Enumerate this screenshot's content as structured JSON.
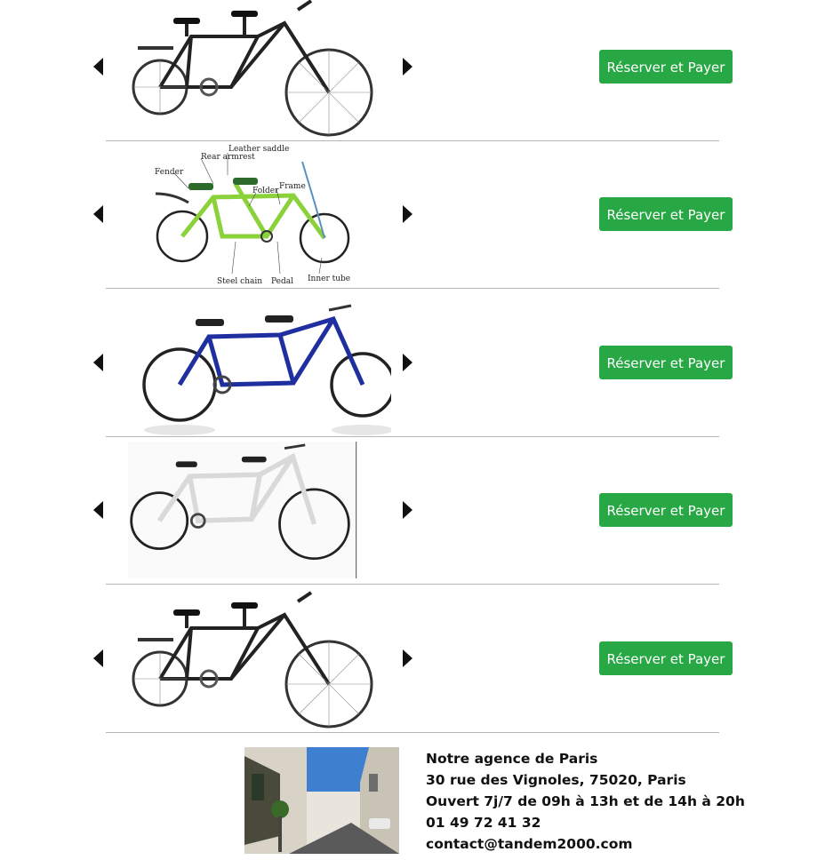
{
  "products": [
    {
      "button_label": "Réserver et Payer",
      "image": "black-tandem-bike",
      "frame_color": "#1e1e1e"
    },
    {
      "button_label": "Réserver et Payer",
      "image": "green-folding-tandem-bike",
      "frame_color": "#8bd13a",
      "annotations": {
        "leather_saddle": "Leather saddle",
        "rear_armrest": "Rear armrest",
        "fender": "Fender",
        "folder": "Folder",
        "frame": "Frame",
        "steel_chain": "Steel chain",
        "pedal": "Pedal",
        "inner_tube": "Inner tube"
      }
    },
    {
      "button_label": "Réserver et Payer",
      "image": "blue-tandem-bike",
      "frame_color": "#1f2fa0"
    },
    {
      "button_label": "Réserver et Payer",
      "image": "white-tandem-bike",
      "frame_color": "#eeeeee"
    },
    {
      "button_label": "Réserver et Payer",
      "image": "black-tandem-bike",
      "frame_color": "#1e1e1e"
    }
  ],
  "agency": {
    "name": "Notre agence de Paris",
    "address": "30 rue des Vignoles, 75020, Paris",
    "hours": "Ouvert 7j/7 de 09h à 13h et de 14h à 20h",
    "phone": "01 49 72 41 32",
    "email": "contact@tandem2000.com",
    "photo": "paris-street-photo"
  },
  "colors": {
    "button": "#28a745",
    "button_text": "#ffffff",
    "separator": "#b5b5b5"
  }
}
